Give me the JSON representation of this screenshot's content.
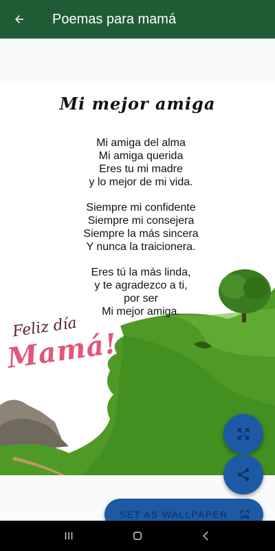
{
  "app_bar": {
    "title": "Poemas para mamá",
    "back_icon": "arrow-back-icon",
    "color": "#1f5c36"
  },
  "poem": {
    "title": "Mi mejor amiga",
    "stanzas": [
      [
        "Mi amiga del alma",
        "Mi amiga querida",
        "Eres tu mi madre",
        "y lo mejor de mi vida."
      ],
      [
        "Siempre mi confidente",
        "Siempre mi consejera",
        "Siempre la más sincera",
        "Y nunca la traicionera."
      ],
      [
        "Eres tú la más linda,",
        "y te agradezco a ti,",
        "por ser",
        "Mi mejor amiga."
      ]
    ],
    "greeting": {
      "line1": "Feliz día",
      "line2": "Mamá!"
    }
  },
  "actions": {
    "expand_icon": "fullscreen-icon",
    "share_icon": "share-icon",
    "wallpaper_label": "SET AS WALLPAPER",
    "wallpaper_icon": "wallpaper-icon",
    "accent": "#1d5aa6"
  },
  "system_nav": {
    "recent_icon": "recent-apps-icon",
    "home_icon": "home-icon",
    "back_icon": "nav-back-icon"
  }
}
